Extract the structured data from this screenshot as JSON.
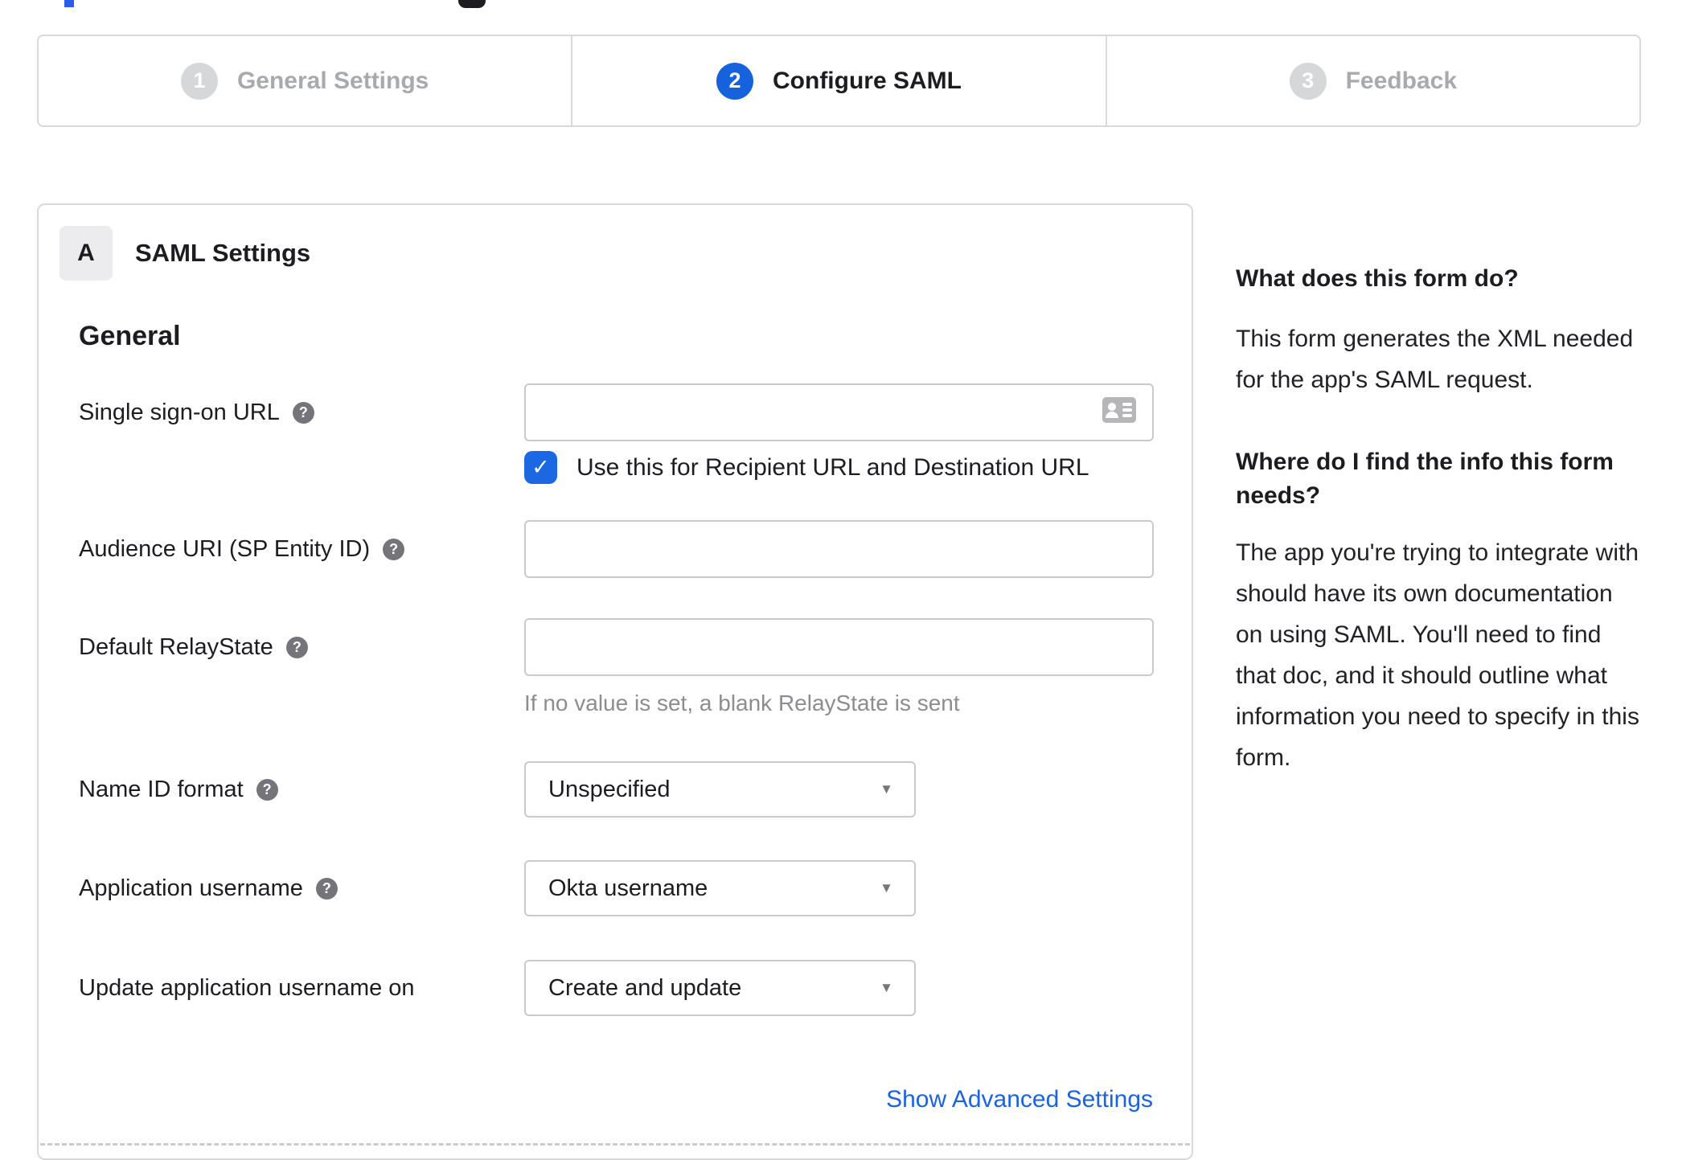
{
  "stepper": {
    "steps": [
      {
        "number": "1",
        "label": "General Settings",
        "state": "inactive"
      },
      {
        "number": "2",
        "label": "Configure SAML",
        "state": "active"
      },
      {
        "number": "3",
        "label": "Feedback",
        "state": "inactive"
      }
    ]
  },
  "panel": {
    "section_badge": "A",
    "section_title": "SAML Settings",
    "group_heading": "General",
    "fields": {
      "sso_url": {
        "label": "Single sign-on URL",
        "value": "",
        "checkbox_label": "Use this for Recipient URL and Destination URL",
        "checkbox_checked": true
      },
      "audience_uri": {
        "label": "Audience URI (SP Entity ID)",
        "value": ""
      },
      "default_relay_state": {
        "label": "Default RelayState",
        "value": "",
        "hint": "If no value is set, a blank RelayState is sent"
      },
      "name_id_format": {
        "label": "Name ID format",
        "value": "Unspecified"
      },
      "application_username": {
        "label": "Application username",
        "value": "Okta username"
      },
      "update_application_username_on": {
        "label": "Update application username on",
        "value": "Create and update"
      }
    },
    "advanced_link": "Show Advanced Settings"
  },
  "sidebar": {
    "sections": [
      {
        "heading": "What does this form do?",
        "body": "This form generates the XML needed for the app's SAML request."
      },
      {
        "heading": "Where do I find the info this form needs?",
        "body": "The app you're trying to integrate with should have its own documentation on using SAML. You'll need to find that doc, and it should outline what information you need to specify in this form."
      }
    ]
  },
  "icons": {
    "help_glyph": "?",
    "check_glyph": "✓",
    "caret_glyph": "▼"
  },
  "colors": {
    "accent_blue": "#1662dd",
    "checkbox_blue": "#1c68e3",
    "link_blue": "#1b63e0",
    "inactive_step_gray": "#a8aaad",
    "text": "#1d1d21",
    "panel_border": "#d9d9db",
    "input_border": "#cacacc",
    "hint_text": "#8d8d91",
    "badge_bg": "#ececee"
  }
}
